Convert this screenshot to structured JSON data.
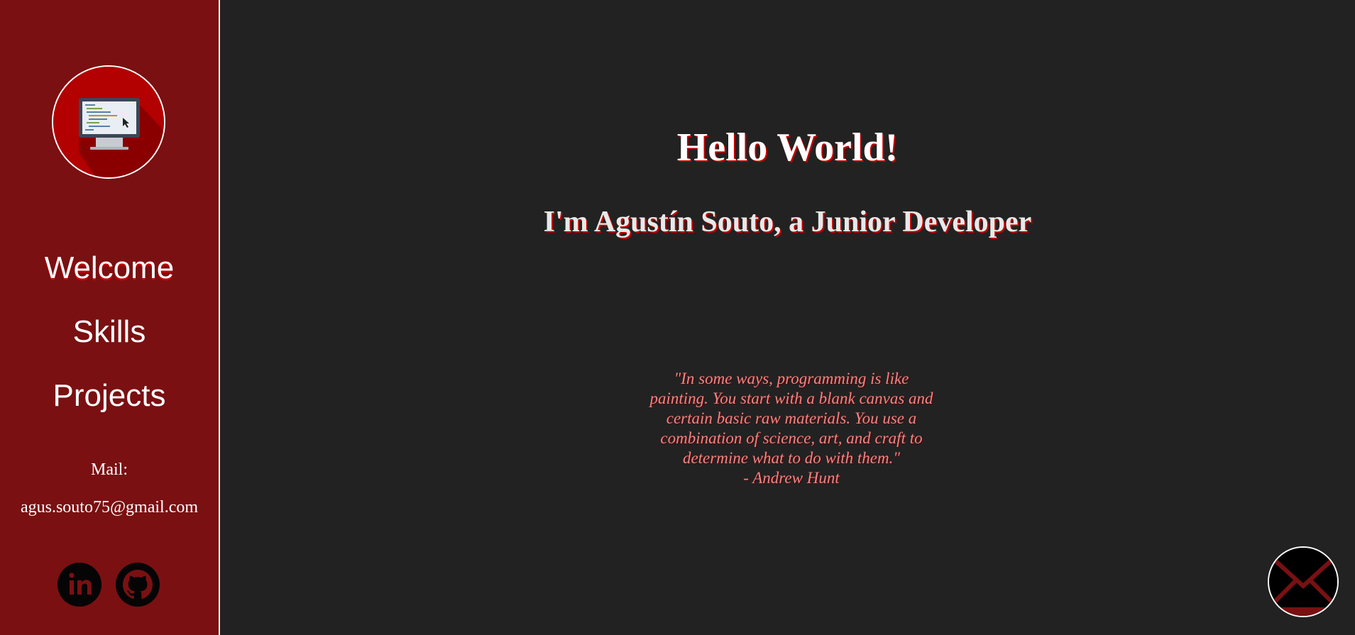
{
  "sidebar": {
    "avatar_icon": "computer-monitor-icon",
    "nav": [
      {
        "label": "Welcome"
      },
      {
        "label": "Skills"
      },
      {
        "label": "Projects"
      }
    ],
    "mail_label": "Mail:",
    "mail_value": "agus.souto75@gmail.com",
    "social": [
      {
        "icon": "linkedin-icon"
      },
      {
        "icon": "github-icon"
      }
    ]
  },
  "main": {
    "title": "Hello World!",
    "subtitle": "I'm Agustín Souto, a Junior Developer",
    "quote_lines": [
      "\"In some ways, programming is like",
      "painting. You start with a blank canvas and",
      "certain basic raw materials. You use a",
      "combination of science, art, and craft to",
      "determine what to do with them.\"",
      "- Andrew Hunt"
    ]
  },
  "fab": {
    "icon": "envelope-icon"
  },
  "colors": {
    "sidebar_bg": "#7a1012",
    "main_bg": "#222222",
    "accent": "#c00000",
    "quote_text": "#f08585"
  }
}
